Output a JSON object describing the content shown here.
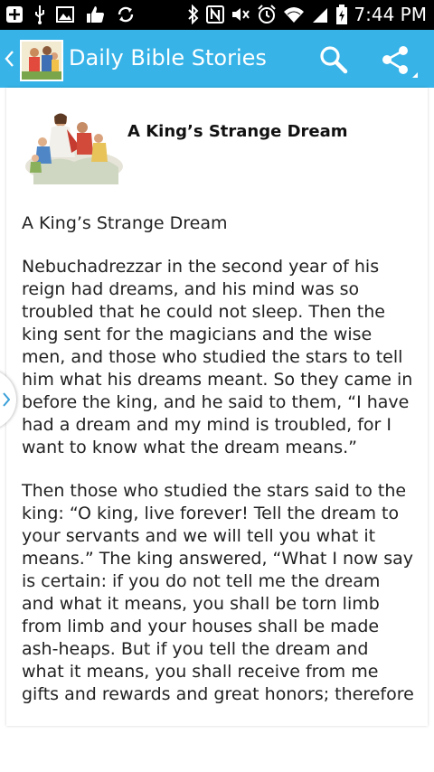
{
  "status_bar": {
    "time": "7:44 PM",
    "icons": [
      "add-notification-icon",
      "usb-icon",
      "image-icon",
      "thumbs-up-icon",
      "sync-icon",
      "bluetooth-icon",
      "nfc-icon",
      "mute-icon",
      "alarm-icon",
      "wifi-icon",
      "signal-icon",
      "battery-icon"
    ]
  },
  "action_bar": {
    "title": "Daily Bible Stories",
    "search_icon": "search-icon",
    "share_icon": "share-icon",
    "accent": "#37b3e8"
  },
  "story": {
    "header_title": "A King’s Strange Dream",
    "title": "A King’s Strange Dream",
    "paragraphs": [
      "Nebuchadrezzar in the second year of his reign had dreams, and his mind was so troubled that he could not sleep. Then the king sent for the magicians and the wise men, and those who studied the stars to tell him what his dreams meant. So they came in before the king, and he said to them, “I have had a dream and my mind is troubled, for I want to know what the dream means.”",
      "Then those who studied the stars said to the king: “O king, live forever! Tell the dream to your servants and we will tell you what it means.” The king answered, “What I now say is certain: if you do not tell me the dream and what it means, you shall be torn limb from limb and your houses shall be made ash-heaps. But if you tell the dream and what it means, you shall receive from me gifts and rewards and great honors; therefore tell me"
    ]
  }
}
